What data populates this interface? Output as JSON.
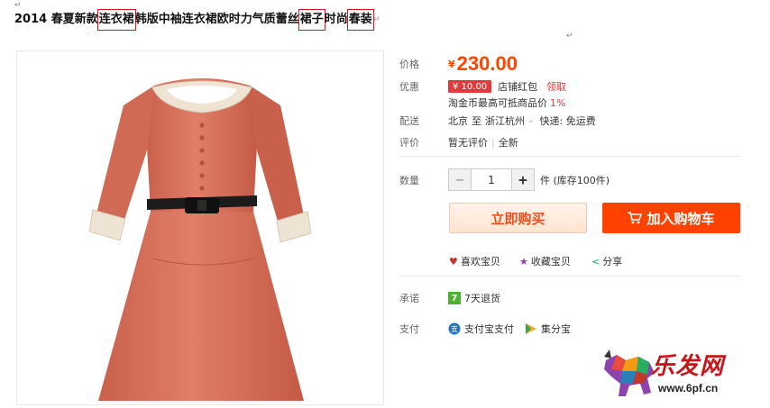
{
  "title": {
    "seg1": "2014 春夏新款",
    "hl1": "连衣裙",
    "seg2": "韩版中袖连衣裙欧时力气质蕾丝",
    "hl2": "裙子",
    "seg3": "时尚",
    "hl3": "春装"
  },
  "para_mark": "↵",
  "price": {
    "label": "价格",
    "currency": "¥",
    "value": "230.00"
  },
  "promo": {
    "label": "优惠",
    "coupon": "¥ 10.00",
    "coupon_text": "店铺红包",
    "claim": "领取",
    "taojinbi": "淘金币最高可抵商品价",
    "taojinbi_pct": "1%"
  },
  "shipping": {
    "label": "配送",
    "from": "北京",
    "to_word": "至",
    "dest": "浙江杭州",
    "fee": "快递: 免运费"
  },
  "review": {
    "label": "评价",
    "none": "暂无评价",
    "new": "全新"
  },
  "quantity": {
    "label": "数量",
    "minus": "−",
    "value": "1",
    "plus": "+",
    "unit": "件 (库存100件)"
  },
  "buttons": {
    "buy_now": "立即购买",
    "add_cart": "加入购物车"
  },
  "social": {
    "like": "喜欢宝贝",
    "favorite": "收藏宝贝",
    "share": "分享"
  },
  "promise": {
    "label": "承诺",
    "badge": "7",
    "text": "7天退货"
  },
  "payment": {
    "label": "支付",
    "alipay": "支付宝支付",
    "jifenbao": "集分宝"
  },
  "watermark": {
    "text": "乐发网",
    "url": "www.6pf.cn"
  },
  "colors": {
    "accent": "#ff4200",
    "price": "#ff4400",
    "highlight_box": "#e0141e",
    "dress": "#d9735e"
  },
  "icons": {
    "chevron": "chevron-down-icon",
    "heart": "heart-icon",
    "star": "star-icon",
    "share": "share-icon",
    "cart": "cart-icon",
    "alipay": "alipay-icon",
    "jifenbao": "jifenbao-icon"
  }
}
